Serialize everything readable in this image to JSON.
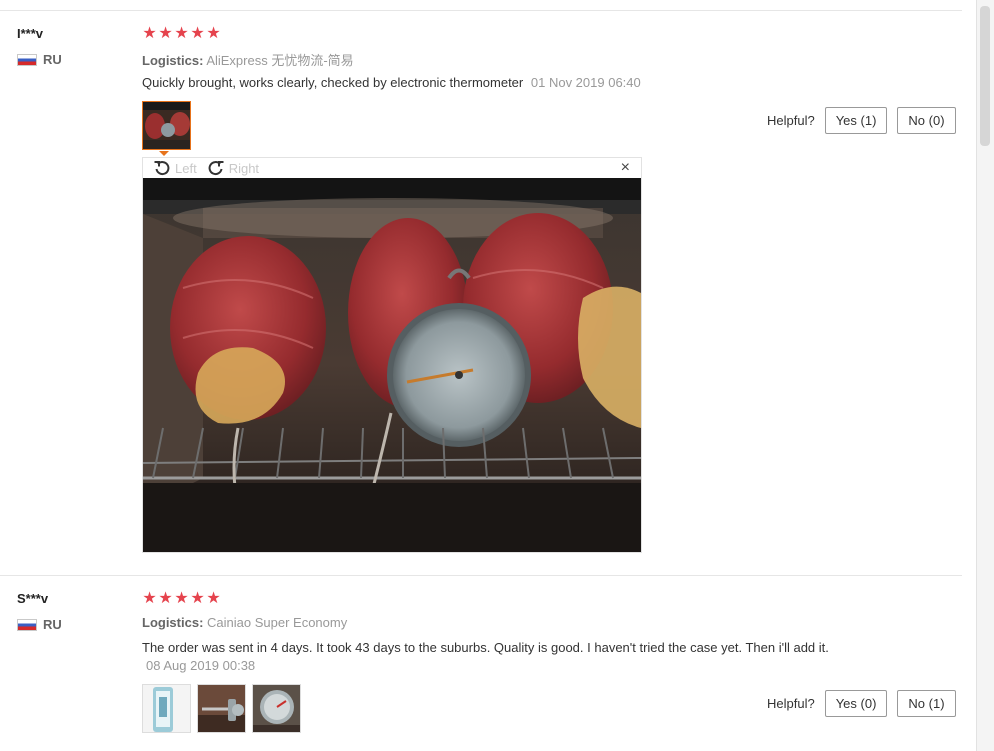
{
  "reviews": [
    {
      "user": "I***v",
      "country": "RU",
      "rating_stars": 5,
      "logistics_label": "Logistics:",
      "logistics_value": "AliExpress 无忧物流-简易",
      "text": "Quickly brought, works clearly, checked by electronic thermometer",
      "date": "01 Nov 2019 06:40",
      "helpful_label": "Helpful?",
      "yes_label": "Yes (1)",
      "no_label": "No (0)",
      "photos": [
        "roast-photo"
      ]
    },
    {
      "user": "S***v",
      "country": "RU",
      "rating_stars": 5,
      "logistics_label": "Logistics:",
      "logistics_value": "Cainiao Super Economy",
      "text": "The order was sent in 4 days. It took 43 days to the suburbs. Quality is good. I haven't tried the case yet. Then i'll add it.",
      "date": "08 Aug 2019 00:38",
      "helpful_label": "Helpful?",
      "yes_label": "Yes (0)",
      "no_label": "No (1)",
      "photos": [
        "package-photo",
        "probe-photo",
        "dial-photo"
      ]
    }
  ],
  "viewer": {
    "rotate_left_label": "Left",
    "rotate_right_label": "Right",
    "close_glyph": "×"
  },
  "icons": {
    "star": "★",
    "rotate_left": "rotate-left-icon",
    "rotate_right": "rotate-right-icon",
    "close": "close-icon"
  },
  "colors": {
    "star": "#e5434d",
    "thumb_active_border": "#e7731b",
    "muted_text": "#999999"
  }
}
